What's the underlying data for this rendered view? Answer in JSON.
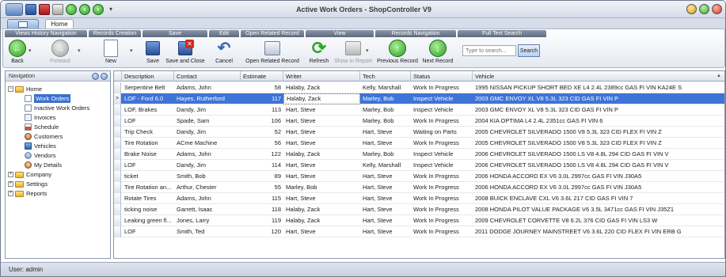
{
  "window": {
    "title": "Active Work Orders - ShopController V9"
  },
  "ribbon": {
    "tab_home": "Home",
    "groups": {
      "views_history": "Views History Navigation",
      "records_creation": "Records Creation",
      "save": "Save",
      "edit": "Edit",
      "open_related": "Open Related Record",
      "view": "View",
      "records_nav": "Records Navigation",
      "full_text_search": "Full Text Search"
    },
    "buttons": {
      "back": "Back",
      "forward": "Forward",
      "new": "New",
      "save": "Save",
      "save_close": "Save and Close",
      "cancel": "Cancel",
      "open_related": "Open Related Record",
      "refresh": "Refresh",
      "show_in_report": "Show in Report",
      "previous_record": "Previous Record",
      "next_record": "Next Record",
      "search": "Search"
    },
    "search_placeholder": "Type to search..."
  },
  "navigation": {
    "header": "Navigation",
    "items": {
      "home": "Home",
      "work_orders": "Work Orders",
      "inactive_work_orders": "Inactive Work Orders",
      "invoices": "Invoices",
      "schedule": "Schedule",
      "customers": "Customers",
      "vehicles": "Vehicles",
      "vendors": "Vendors",
      "my_details": "My Details",
      "company": "Company",
      "settings": "Settings",
      "reports": "Reports"
    }
  },
  "grid": {
    "columns": [
      "Description",
      "Contact",
      "Estimate",
      "Writer",
      "Tech",
      "Status",
      "Vehicle"
    ],
    "rows": [
      [
        "Serpentine Belt",
        "Adams, John",
        "58",
        "Halaby, Zack",
        "Kelly, Marshall",
        "Work In Progress",
        "1995 NISSAN PICKUP SHORT BED XE L4 2.4L 2389cc GAS FI VIN KA24E S"
      ],
      [
        "LOF - Ford 6.0",
        "Hayes, Rutherford",
        "117",
        "Halaby, Zack",
        "Marley, Bob",
        "Inspect Vehicle",
        "2003 GMC ENVOY XL V8 5.3L 323 CID GAS FI VIN  P"
      ],
      [
        "LOF, Brakes",
        "Dandy, Jim",
        "113",
        "Hart, Steve",
        "Marley, Bob",
        "Inspect Vehicle",
        "2003 GMC ENVOY XL V8 5.3L 323 CID GAS FI VIN  P"
      ],
      [
        "LOF",
        "Spade, Sam",
        "106",
        "Hart, Steve",
        "Marley, Bob",
        "Work In Progress",
        "2004 KIA OPTIMA L4 2.4L 2351cc GAS FI VIN  6"
      ],
      [
        "Trip Check",
        "Dandy, Jim",
        "52",
        "Hart, Steve",
        "Hart, Steve",
        "Waiting on Parts",
        "2005 CHEVROLET SILVERADO 1500 V8 5.3L 323 CID FLEX FI VIN  Z"
      ],
      [
        "Tire Rotation",
        "ACme Machine",
        "56",
        "Hart, Steve",
        "Hart, Steve",
        "Work In Progress",
        "2005 CHEVROLET SILVERADO 1500 V8 5.3L 323 CID FLEX FI VIN  Z"
      ],
      [
        "Brake Noise",
        "Adams, John",
        "122",
        "Halaby, Zack",
        "Marley, Bob",
        "Inspect Vehicle",
        "2006 CHEVROLET SILVERADO 1500 LS V8 4.8L 294 CID GAS FI VIN  V"
      ],
      [
        "LOF",
        "Dandy, Jim",
        "114",
        "Hart, Steve",
        "Kelly, Marshall",
        "Inspect Vehicle",
        "2006 CHEVROLET SILVERADO 1500 LS V8 4.8L 294 CID GAS FI VIN  V"
      ],
      [
        "ticket",
        "Smith, Bob",
        "89",
        "Hart, Steve",
        "Hart, Steve",
        "Work In Progress",
        "2006 HONDA ACCORD EX V6 3.0L 2997cc GAS FI VIN J30A5"
      ],
      [
        "Tire Rotation an...",
        "Arthur, Chester",
        "55",
        "Marley, Bob",
        "Hart, Steve",
        "Work In Progress",
        "2006 HONDA ACCORD EX V6 3.0L 2997cc GAS FI VIN J30A5"
      ],
      [
        "Rotate Tires",
        "Adams, John",
        "115",
        "Hart, Steve",
        "Hart, Steve",
        "Work In Progress",
        "2008 BUICK ENCLAVE CXL V6 3.6L 217 CID GAS FI VIN  7"
      ],
      [
        "ticking noise",
        "Garrett, Isaac",
        "118",
        "Halaby, Zack",
        "Hart, Steve",
        "Work In Progress",
        "2008 HONDA PILOT VALUE PACKAGE V6 3.5L 3471cc GAS FI VIN J35Z1"
      ],
      [
        "Leaking green fl...",
        "Jones, Larry",
        "119",
        "Halaby, Zack",
        "Hart, Steve",
        "Work In Progress",
        "2009 CHEVROLET CORVETTE V8 6.2L 376 CID GAS FI VIN LS3 W"
      ],
      [
        "LOF",
        "Smith, Ted",
        "120",
        "Hart, Steve",
        "Hart, Steve",
        "Work In Progress",
        "2011 DODGE JOURNEY MAINSTREET V6 3.6L 220 CID FLEX FI VIN ERB G"
      ]
    ],
    "selected_row_indicator": ">"
  },
  "status": {
    "user": "User: admin"
  }
}
